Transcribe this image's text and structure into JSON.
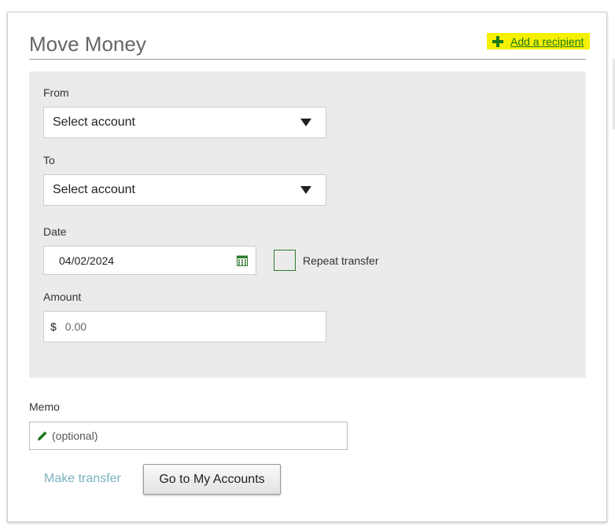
{
  "page": {
    "title": "Move Money",
    "add_recipient_label": "Add a recipient"
  },
  "form": {
    "from_label": "From",
    "from_value": "Select account",
    "to_label": "To",
    "to_value": "Select account",
    "date_label": "Date",
    "date_value": "04/02/2024",
    "repeat_label": "Repeat transfer",
    "amount_label": "Amount",
    "currency_symbol": "$",
    "amount_placeholder": "0.00",
    "memo_label": "Memo",
    "memo_placeholder": "(optional)"
  },
  "actions": {
    "make_transfer_label": "Make transfer",
    "go_to_accounts_label": "Go to My Accounts"
  },
  "colors": {
    "accent_green": "#1a7a1a",
    "highlight_yellow": "#f5ef00",
    "panel_gray": "#ebebeb",
    "disabled_link": "#7ab3bf"
  },
  "icons": [
    "plus-icon",
    "chevron-down-icon",
    "calendar-icon",
    "pencil-icon"
  ]
}
